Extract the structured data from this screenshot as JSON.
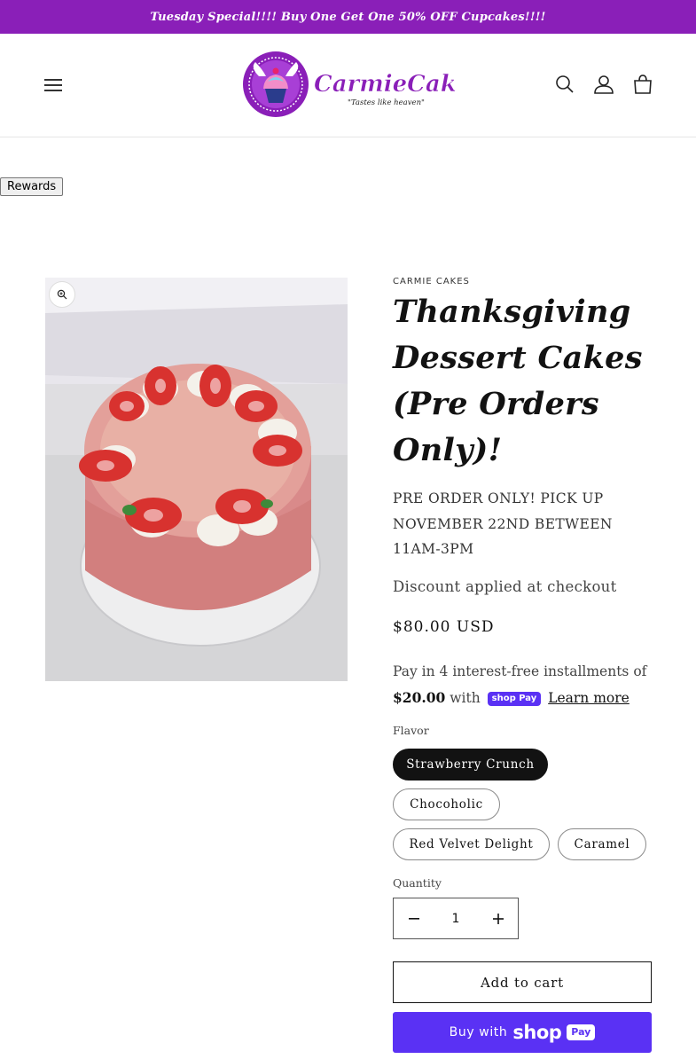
{
  "announcement": {
    "text": "Tuesday Special!!!! Buy One Get One 50% OFF Cupcakes!!!!"
  },
  "header": {
    "logo_brand": "CarmieCakes",
    "logo_tagline": "\"Tastes like heaven\"",
    "icons": [
      "menu-icon",
      "search-icon",
      "account-icon",
      "cart-icon"
    ]
  },
  "rewards": {
    "label": "Rewards"
  },
  "product": {
    "vendor": "CARMIE CAKES",
    "title": "Thanksgiving Dessert Cakes (Pre Orders Only)!",
    "preorder_note": "PRE ORDER ONLY! PICK UP NOVEMBER 22ND BETWEEN 11AM-3PM",
    "discount_note": "Discount applied at checkout",
    "price": "$80.00 USD",
    "installments": {
      "prefix": "Pay in 4 interest-free installments of",
      "amount": "$20.00",
      "with": "with",
      "badge": "shop Pay",
      "learn_more": "Learn more"
    },
    "flavor_label": "Flavor",
    "flavors": [
      "Strawberry Crunch",
      "Chocoholic",
      "Red Velvet Delight",
      "Caramel"
    ],
    "selected_flavor": "Strawberry Crunch",
    "quantity_label": "Quantity",
    "quantity": "1",
    "add_to_cart": "Add to cart",
    "buy_with": "Buy with",
    "shop_word": "shop",
    "pay_word": "Pay"
  },
  "colors": {
    "brand_purple": "#8a1fb8",
    "shoppay_purple": "#5a31f4",
    "text_dark": "#121212"
  }
}
